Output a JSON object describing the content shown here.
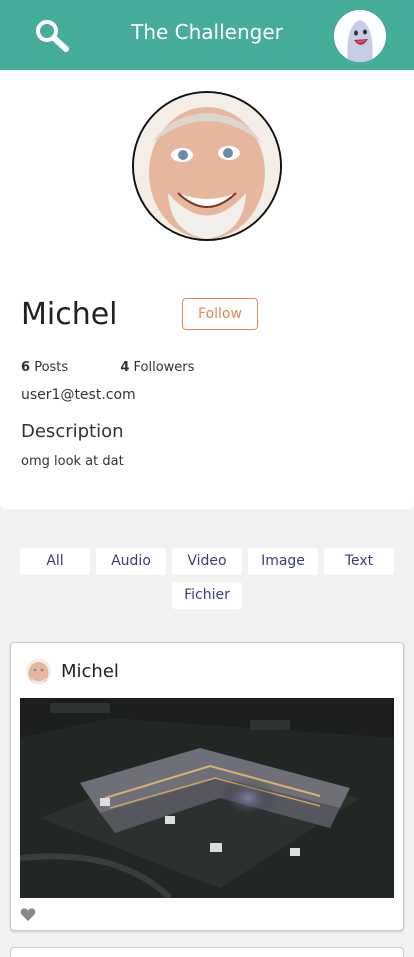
{
  "header": {
    "title": "The Challenger",
    "icons": {
      "search": "search-icon",
      "avatar": "user-avatar"
    },
    "color": "#45ad99"
  },
  "profile": {
    "name": "Michel",
    "follow_label": "Follow",
    "posts_count": "6",
    "posts_label": "Posts",
    "followers_count": "4",
    "followers_label": "Followers",
    "email": "user1@test.com",
    "description_title": "Description",
    "description": "omg look at dat",
    "accent_color": "#e08a5c"
  },
  "filters": [
    "All",
    "Audio",
    "Video",
    "Image",
    "Text",
    "Fichier"
  ],
  "posts": [
    {
      "author": "Michel",
      "media": "night aerial view of building",
      "like_icon": "heart-icon"
    }
  ]
}
